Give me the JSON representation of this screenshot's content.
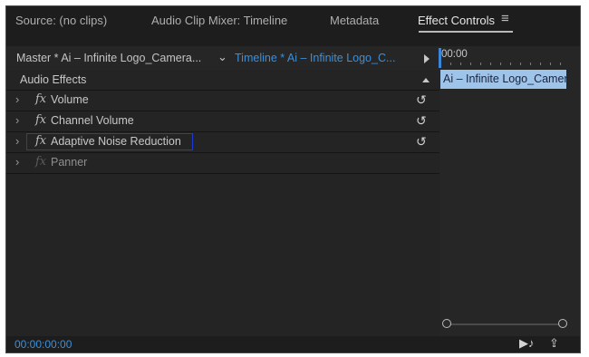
{
  "tabs": [
    {
      "label": "Source: (no clips)"
    },
    {
      "label": "Audio Clip Mixer: Timeline"
    },
    {
      "label": "Metadata"
    },
    {
      "label": "Effect Controls"
    }
  ],
  "tab_menu_icon": "≡",
  "source": {
    "master": "Master * Ai – Infinite Logo_Camera...",
    "sequence": "Timeline * Ai – Infinite Logo_C..."
  },
  "section": {
    "label": "Audio Effects"
  },
  "effects": [
    {
      "fx": "fx",
      "label": "Volume"
    },
    {
      "fx": "fx",
      "label": "Channel Volume"
    },
    {
      "fx": "fx",
      "label": "Adaptive Noise Reduction"
    },
    {
      "fx": "fx",
      "label": "Panner"
    }
  ],
  "timeline": {
    "ruler_time": "00:00",
    "clip_label": "Ai – Infinite Logo_Camera"
  },
  "footer": {
    "timecode": "00:00:00:00"
  },
  "icons": {
    "expand": "›",
    "reset": "↺",
    "chevron": "⌄",
    "play_audio": "▶♪",
    "export": "⇪"
  },
  "colors": {
    "panel_bg": "#1d1d1d",
    "accent_blue": "#3d8fd8",
    "selection_border": "#1c3bd4",
    "clip_bg": "#9fc4ea"
  }
}
